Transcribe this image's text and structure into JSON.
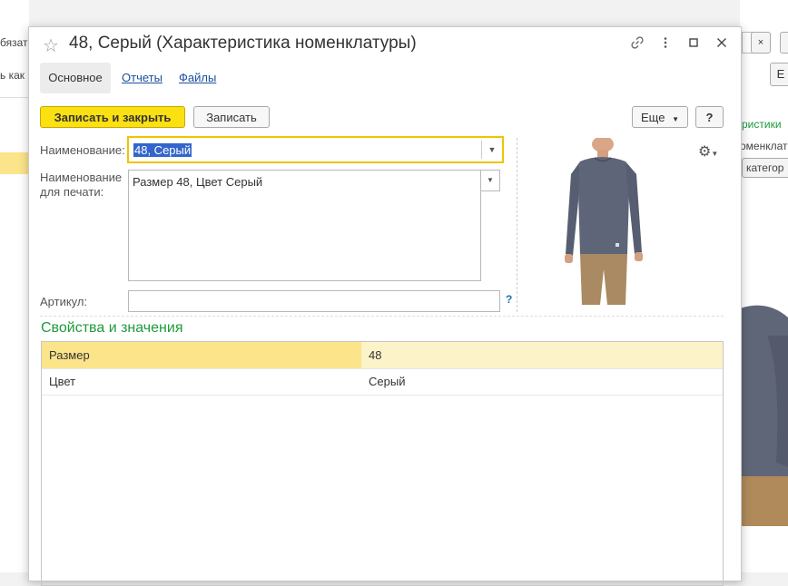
{
  "background": {
    "left_text_1": "бязат",
    "left_text_2": "ь как",
    "right_text_1": "ристики",
    "right_text_2": "оменклат",
    "right_text_3": "категор",
    "right_btn": "Е"
  },
  "window": {
    "title": "48, Серый (Характеристика номенклатуры)"
  },
  "tabs": [
    {
      "label": "Основное"
    },
    {
      "label": "Отчеты"
    },
    {
      "label": "Файлы"
    }
  ],
  "toolbar": {
    "save_close_label": "Записать и закрыть",
    "save_label": "Записать",
    "more_label": "Еще",
    "help_label": "?"
  },
  "form": {
    "name_label": "Наименование:",
    "name_value": "48, Серый",
    "print_name_label_1": "Наименование",
    "print_name_label_2": "для печати:",
    "print_name_value": "Размер 48, Цвет Серый",
    "article_label": "Артикул:",
    "article_value": "",
    "article_help": "?"
  },
  "properties": {
    "section_title": "Свойства и значения",
    "rows": [
      {
        "name": "Размер",
        "value": "48"
      },
      {
        "name": "Цвет",
        "value": "Серый"
      }
    ]
  },
  "colors": {
    "accent_yellow": "#fbe012",
    "section_green": "#1e9a3c",
    "link_blue": "#1a4fa0",
    "selected_row": "#fbe48a",
    "selected_row_value": "#fdf3c8"
  }
}
